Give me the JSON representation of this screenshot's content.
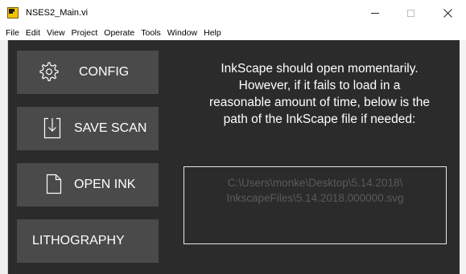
{
  "window": {
    "title": "NSES2_Main.vi"
  },
  "menu": [
    "File",
    "Edit",
    "View",
    "Project",
    "Operate",
    "Tools",
    "Window",
    "Help"
  ],
  "buttons": {
    "config": "CONFIG",
    "save_scan": "SAVE SCAN",
    "open_ink": "OPEN INK",
    "lithography": "LITHOGRAPHY"
  },
  "message": {
    "line1": "InkScape should open momentarily.",
    "line2": "However, if it fails to load in a",
    "line3": "reasonable amount of time, below is the",
    "line4": "path of the InkScape file if needed:"
  },
  "path": {
    "line1": "C:\\Users\\monke\\Desktop\\5.14.2018\\",
    "line2": "InkscapeFiles\\5.14.2018.000000.svg"
  },
  "colors": {
    "panel_bg": "#2b2b2b",
    "button_bg": "#4a4a4a",
    "path_text": "#5a5a5a"
  }
}
